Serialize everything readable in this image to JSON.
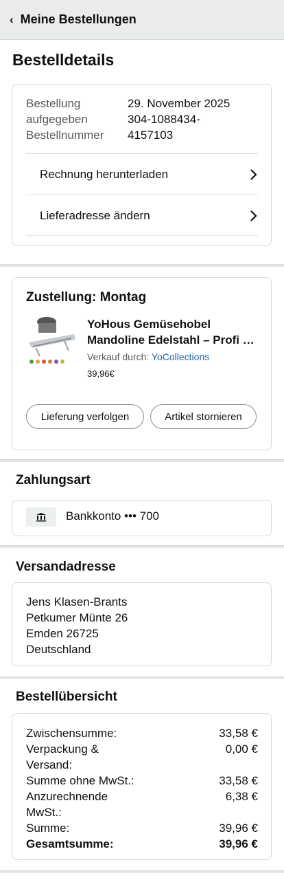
{
  "topbar": {
    "back_label": "Meine Bestellungen"
  },
  "page_title": "Bestelldetails",
  "order_info": {
    "labels": [
      "Bestellung",
      "aufgegeben",
      "Bestellnummer"
    ],
    "values": [
      "29. November 2025",
      "304-1088434-",
      "4157103"
    ],
    "links": [
      {
        "label": "Rechnung herunterladen"
      },
      {
        "label": "Lieferadresse ändern"
      }
    ]
  },
  "shipment": {
    "heading": "Zustellung: Montag",
    "product_title_line1": "YoHous Gemüsehobel",
    "product_title_line2": "Mandoline Edelstahl – Profi Mandoline",
    "seller_prefix": "Verkauf durch:",
    "seller_name": "YoCollections",
    "price": "39,96€",
    "track_button": "Lieferung verfolgen",
    "cancel_button": "Artikel stornieren"
  },
  "payment": {
    "heading": "Zahlungsart",
    "method": "Bankkonto ••• 700",
    "icon": "bank-icon"
  },
  "shipping_address": {
    "heading": "Versandadresse",
    "lines": [
      "Jens Klasen-Brants",
      "Petkumer Münte 26",
      "Emden 26725",
      "Deutschland"
    ]
  },
  "summary": {
    "heading": "Bestellübersicht",
    "rows": [
      {
        "label": "Zwischensumme:",
        "value": "33,58 €"
      },
      {
        "label": "Verpackung & Versand:",
        "value": "0,00 €"
      },
      {
        "label": "Summe ohne MwSt.:",
        "value": "33,58 €"
      },
      {
        "label": "Anzurechnende MwSt.:",
        "value": "6,38 €"
      },
      {
        "label": "Summe:",
        "value": "39,96 €"
      },
      {
        "label": "Gesamtsumme:",
        "value": "39,96 €"
      }
    ]
  },
  "colors": {
    "link": "#2162a1",
    "band": "#e3e6e6",
    "topbar": "#e9ebed"
  }
}
